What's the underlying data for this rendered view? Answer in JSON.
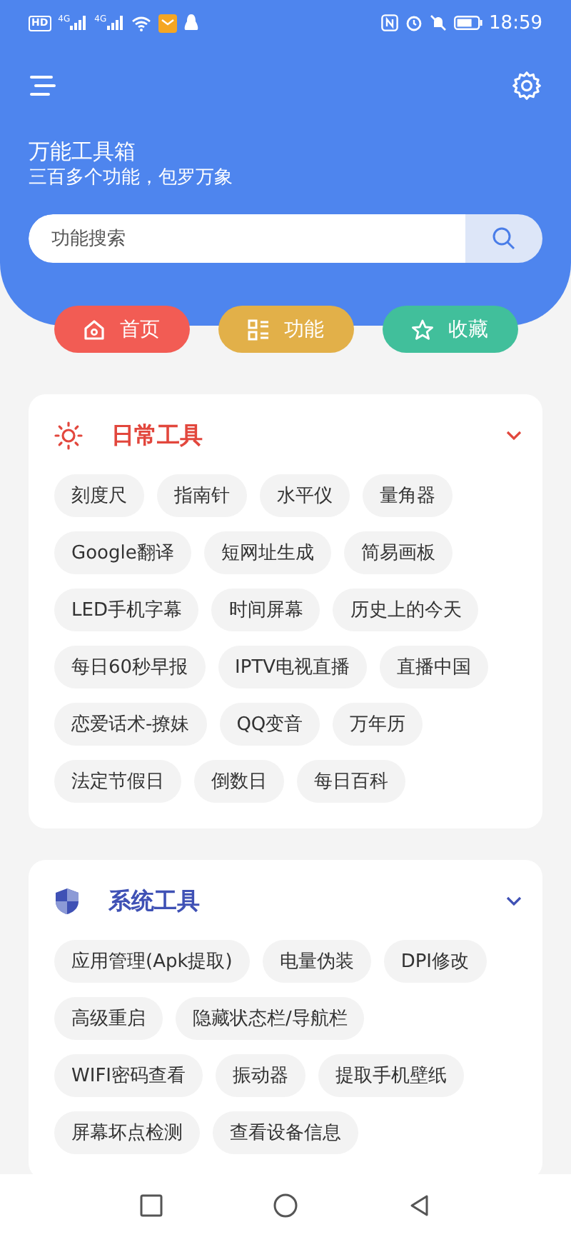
{
  "status_bar": {
    "badge": "HD",
    "signals": [
      {
        "label": "4G"
      },
      {
        "label": "4G"
      }
    ],
    "time": "18:59"
  },
  "header": {
    "title": "万能工具箱",
    "subtitle": "三百多个功能，包罗万象"
  },
  "search": {
    "placeholder": "功能搜索"
  },
  "nav_buttons": [
    {
      "label": "首页",
      "kind": "home",
      "color": "#f25c54"
    },
    {
      "label": "功能",
      "kind": "grid",
      "color": "#e2b049"
    },
    {
      "label": "收藏",
      "kind": "star",
      "color": "#41bf9b"
    }
  ],
  "sections": [
    {
      "title": "日常工具",
      "kind": "sun",
      "color": "#e2473d",
      "expanded": true,
      "items": [
        "刻度尺",
        "指南针",
        "水平仪",
        "量角器",
        "Google翻译",
        "短网址生成",
        "简易画板",
        "LED手机字幕",
        "时间屏幕",
        "历史上的今天",
        "每日60秒早报",
        "IPTV电视直播",
        "直播中国",
        "恋爱话术-撩妹",
        "QQ变音",
        "万年历",
        "法定节假日",
        "倒数日",
        "每日百科"
      ]
    },
    {
      "title": "系统工具",
      "kind": "shield",
      "color": "#3f51b5",
      "expanded": true,
      "items": [
        "应用管理(Apk提取)",
        "电量伪装",
        "DPI修改",
        "高级重启",
        "隐藏状态栏/导航栏",
        "WIFI密码查看",
        "振动器",
        "提取手机壁纸",
        "屏幕坏点检测",
        "查看设备信息"
      ]
    }
  ]
}
